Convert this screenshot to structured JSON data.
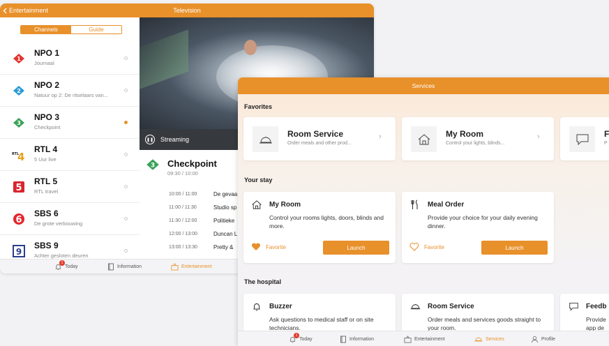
{
  "tv": {
    "back_label": "Entertainment",
    "title": "Television",
    "segment": {
      "channels": "Channels",
      "guide": "Guide"
    },
    "channels": [
      {
        "name": "NPO 1",
        "sub": "Journaal",
        "selected": false
      },
      {
        "name": "NPO 2",
        "sub": "Natuur op 2: De ritselaars van...",
        "selected": false
      },
      {
        "name": "NPO 3",
        "sub": "Checkpoint",
        "selected": true
      },
      {
        "name": "RTL 4",
        "sub": "5 Uur live",
        "selected": false
      },
      {
        "name": "RTL 5",
        "sub": "RTL travel",
        "selected": false
      },
      {
        "name": "SBS 6",
        "sub": "De grote verbouwing",
        "selected": false
      },
      {
        "name": "SBS 9",
        "sub": "Achter gesloten deuren",
        "selected": false
      }
    ],
    "stream_label": "Streaming",
    "program": {
      "title": "Checkpoint",
      "time": "09:30 / 10:00"
    },
    "schedule": [
      {
        "time": "10:00 / 11:00",
        "title": "De gevaa"
      },
      {
        "time": "11:00 / 11:30",
        "title": "Studio sp"
      },
      {
        "time": "11:30 / 12:00",
        "title": "Politieke"
      },
      {
        "time": "12:00 / 13:00",
        "title": "Duncan L"
      },
      {
        "time": "13:00 / 13:30",
        "title": "Pretty &"
      }
    ],
    "tabs": {
      "today": "Today",
      "information": "Information",
      "entertainment": "Entertainment",
      "badge": "1"
    }
  },
  "services": {
    "title": "Services",
    "favorites_heading": "Favorites",
    "favorites": [
      {
        "title": "Room Service",
        "sub": "Order meals and other prod..."
      },
      {
        "title": "My Room",
        "sub": "Control your lights, blinds..."
      },
      {
        "title": "F",
        "sub": "P"
      }
    ],
    "stay_heading": "Your stay",
    "stay": [
      {
        "title": "My Room",
        "desc": "Control your rooms lights, doors, blinds and more.",
        "favorite_label": "Favorite",
        "launch_label": "Launch",
        "favorited": true
      },
      {
        "title": "Meal Order",
        "desc": "Provide your choice for your daily evening dinner.",
        "favorite_label": "Favorite",
        "launch_label": "Launch",
        "favorited": false
      }
    ],
    "hospital_heading": "The hospital",
    "hospital": [
      {
        "title": "Buzzer",
        "desc": "Ask questions to medical staff or on site technicians."
      },
      {
        "title": "Room Service",
        "desc": "Order meals and services goods straight to your room."
      },
      {
        "title": "Feedb",
        "desc": "Provide app de"
      }
    ],
    "tabs": {
      "today": "Today",
      "information": "Information",
      "entertainment": "Entertainment",
      "services": "Services",
      "profile": "Profile",
      "badge": "1"
    }
  },
  "colors": {
    "accent": "#e8902a",
    "badge": "#e33b2e"
  }
}
